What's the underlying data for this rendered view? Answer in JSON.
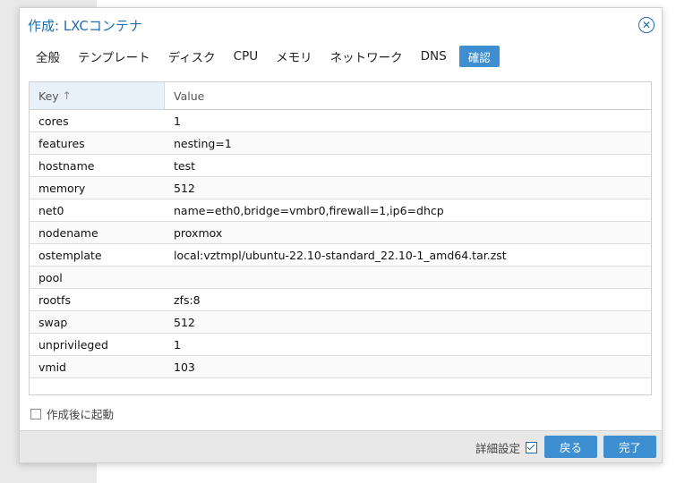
{
  "dialog": {
    "title": "作成: LXCコンテナ",
    "close_icon": "close-circle-icon"
  },
  "tabs": [
    {
      "label": "全般",
      "active": false
    },
    {
      "label": "テンプレート",
      "active": false
    },
    {
      "label": "ディスク",
      "active": false
    },
    {
      "label": "CPU",
      "active": false
    },
    {
      "label": "メモリ",
      "active": false
    },
    {
      "label": "ネットワーク",
      "active": false
    },
    {
      "label": "DNS",
      "active": false
    },
    {
      "label": "確認",
      "active": true
    }
  ],
  "grid": {
    "columns": {
      "key": "Key",
      "value": "Value"
    },
    "sort_icon": "arrow-up-icon",
    "rows": [
      {
        "key": "cores",
        "value": "1"
      },
      {
        "key": "features",
        "value": "nesting=1"
      },
      {
        "key": "hostname",
        "value": "test"
      },
      {
        "key": "memory",
        "value": "512"
      },
      {
        "key": "net0",
        "value": "name=eth0,bridge=vmbr0,firewall=1,ip6=dhcp"
      },
      {
        "key": "nodename",
        "value": "proxmox"
      },
      {
        "key": "ostemplate",
        "value": "local:vztmpl/ubuntu-22.10-standard_22.10-1_amd64.tar.zst"
      },
      {
        "key": "pool",
        "value": ""
      },
      {
        "key": "rootfs",
        "value": "zfs:8"
      },
      {
        "key": "swap",
        "value": "512"
      },
      {
        "key": "unprivileged",
        "value": "1"
      },
      {
        "key": "vmid",
        "value": "103"
      }
    ]
  },
  "start_after_created": {
    "label": "作成後に起動",
    "checked": false
  },
  "footer": {
    "advanced_label": "詳細設定",
    "advanced_checked": true,
    "back_label": "戻る",
    "finish_label": "完了"
  },
  "colors": {
    "accent": "#3d8fd1",
    "title": "#1f6cb0"
  }
}
